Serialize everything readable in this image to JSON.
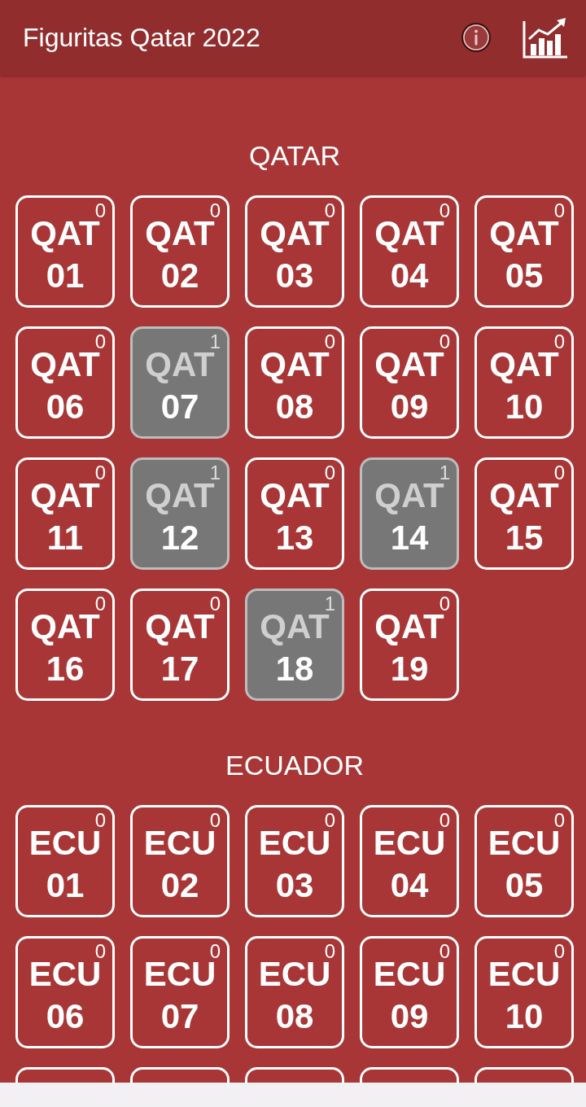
{
  "app_bar": {
    "title": "Figuritas Qatar 2022"
  },
  "sections": [
    {
      "title": "QATAR",
      "stickers": [
        {
          "kind": "tile",
          "code": "QAT",
          "number": "01",
          "count": "0",
          "owned": false
        },
        {
          "kind": "tile",
          "code": "QAT",
          "number": "02",
          "count": "0",
          "owned": false
        },
        {
          "kind": "tile",
          "code": "QAT",
          "number": "03",
          "count": "0",
          "owned": false
        },
        {
          "kind": "tile",
          "code": "QAT",
          "number": "04",
          "count": "0",
          "owned": false
        },
        {
          "kind": "tile",
          "code": "QAT",
          "number": "05",
          "count": "0",
          "owned": false
        },
        {
          "kind": "tile",
          "code": "QAT",
          "number": "06",
          "count": "0",
          "owned": false
        },
        {
          "kind": "tile",
          "code": "QAT",
          "number": "07",
          "count": "1",
          "owned": true
        },
        {
          "kind": "tile",
          "code": "QAT",
          "number": "08",
          "count": "0",
          "owned": false
        },
        {
          "kind": "tile",
          "code": "QAT",
          "number": "09",
          "count": "0",
          "owned": false
        },
        {
          "kind": "tile",
          "code": "QAT",
          "number": "10",
          "count": "0",
          "owned": false
        },
        {
          "kind": "tile",
          "code": "QAT",
          "number": "11",
          "count": "0",
          "owned": false
        },
        {
          "kind": "tile",
          "code": "QAT",
          "number": "12",
          "count": "1",
          "owned": true
        },
        {
          "kind": "tile",
          "code": "QAT",
          "number": "13",
          "count": "0",
          "owned": false
        },
        {
          "kind": "tile",
          "code": "QAT",
          "number": "14",
          "count": "1",
          "owned": true
        },
        {
          "kind": "tile",
          "code": "QAT",
          "number": "15",
          "count": "0",
          "owned": false
        },
        {
          "kind": "tile",
          "code": "QAT",
          "number": "16",
          "count": "0",
          "owned": false
        },
        {
          "kind": "tile",
          "code": "QAT",
          "number": "17",
          "count": "0",
          "owned": false
        },
        {
          "kind": "tile",
          "code": "QAT",
          "number": "18",
          "count": "1",
          "owned": true
        },
        {
          "kind": "tile",
          "code": "QAT",
          "number": "19",
          "count": "0",
          "owned": false
        }
      ]
    },
    {
      "title": "ECUADOR",
      "stickers": [
        {
          "kind": "tile",
          "code": "ECU",
          "number": "01",
          "count": "0",
          "owned": false
        },
        {
          "kind": "tile",
          "code": "ECU",
          "number": "02",
          "count": "0",
          "owned": false
        },
        {
          "kind": "tile",
          "code": "ECU",
          "number": "03",
          "count": "0",
          "owned": false
        },
        {
          "kind": "tile",
          "code": "ECU",
          "number": "04",
          "count": "0",
          "owned": false
        },
        {
          "kind": "tile",
          "code": "ECU",
          "number": "05",
          "count": "0",
          "owned": false
        },
        {
          "kind": "tile",
          "code": "ECU",
          "number": "06",
          "count": "0",
          "owned": false
        },
        {
          "kind": "tile",
          "code": "ECU",
          "number": "07",
          "count": "0",
          "owned": false
        },
        {
          "kind": "tile",
          "code": "ECU",
          "number": "08",
          "count": "0",
          "owned": false
        },
        {
          "kind": "tile",
          "code": "ECU",
          "number": "09",
          "count": "0",
          "owned": false
        },
        {
          "kind": "tile",
          "code": "ECU",
          "number": "10",
          "count": "0",
          "owned": false
        },
        {
          "kind": "cut",
          "owned": false
        },
        {
          "kind": "cut",
          "owned": false
        },
        {
          "kind": "cut",
          "owned": false
        },
        {
          "kind": "cut",
          "owned": false
        },
        {
          "kind": "cut",
          "owned": false
        }
      ]
    }
  ]
}
